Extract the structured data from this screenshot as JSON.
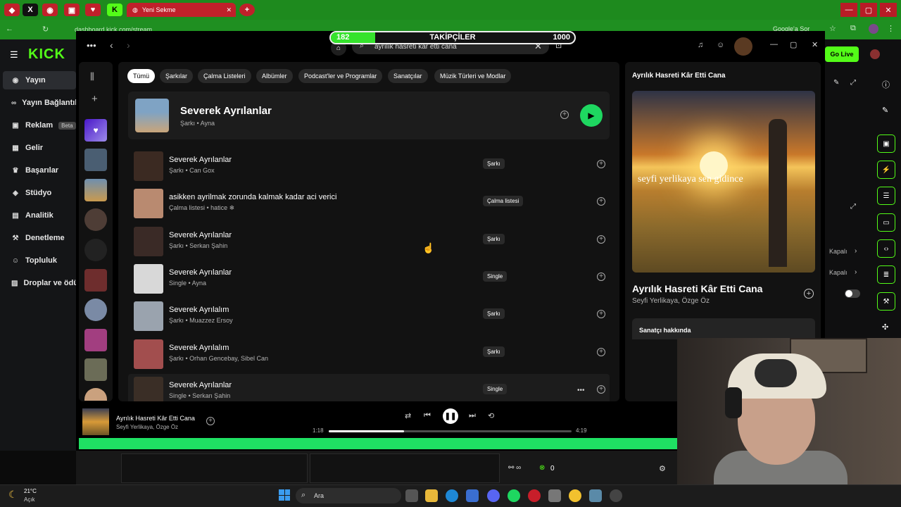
{
  "browser": {
    "tab_title": "Yeni Sekme",
    "url": "dashboard.kick.com/stream",
    "google_signin": "Google'a Sor"
  },
  "kick": {
    "logo": "KICK",
    "nav": [
      {
        "label": "Yayın",
        "icon": "broadcast-icon"
      },
      {
        "label": "Yayın Bağlantıları",
        "icon": "link-icon"
      },
      {
        "label": "Reklam",
        "icon": "ad-icon"
      },
      {
        "label": "Gelir",
        "icon": "revenue-icon"
      },
      {
        "label": "Başarılar",
        "icon": "trophy-icon"
      },
      {
        "label": "Stüdyo",
        "icon": "studio-icon"
      },
      {
        "label": "Analitik",
        "icon": "analytics-icon"
      },
      {
        "label": "Denetleme",
        "icon": "moderation-icon"
      },
      {
        "label": "Topluluk",
        "icon": "community-icon"
      },
      {
        "label": "Droplar ve ödüller",
        "icon": "drops-icon"
      }
    ],
    "beta_label": "Beta",
    "go_live": "Go Live",
    "kapali_1": "Kapalı",
    "kapali_2": "Kapalı"
  },
  "overlay": {
    "follower_label": "TAKİPÇİLER",
    "follower_current": "182",
    "follower_goal": "1000",
    "follower_fraction": 0.182
  },
  "search": {
    "query": "ayrılık hasreti kar etti cana"
  },
  "filters": [
    "Tümü",
    "Şarkılar",
    "Çalma Listeleri",
    "Albümler",
    "Podcast'ler ve Programlar",
    "Sanatçılar",
    "Müzik Türleri ve Modlar"
  ],
  "top_result": {
    "title": "Severek Ayrılanlar",
    "subtitle": "Şarkı • Ayna"
  },
  "results": [
    {
      "title": "Severek Ayrılanlar",
      "subtitle": "Şarkı • Can Gox",
      "type": "Şarkı"
    },
    {
      "title": "asikken ayrilmak zorunda kalmak kadar aci verici",
      "subtitle": "Çalma listesi • hatice ❄",
      "type": "Çalma listesi"
    },
    {
      "title": "Severek Ayrılanlar",
      "subtitle": "Şarkı • Serkan Şahin",
      "type": "Şarkı"
    },
    {
      "title": "Severek Ayrılanlar",
      "subtitle": "Single • Ayna",
      "type": "Single"
    },
    {
      "title": "Severek Ayrılalım",
      "subtitle": "Şarkı • Muazzez Ersoy",
      "type": "Şarkı"
    },
    {
      "title": "Severek Ayrılalım",
      "subtitle": "Şarkı • Orhan Gencebay, Sibel Can",
      "type": "Şarkı"
    },
    {
      "title": "Severek Ayrılanlar",
      "subtitle": "Single • Serkan Şahin",
      "type": "Single"
    }
  ],
  "now_playing_panel": {
    "header": "Ayrılık Hasreti Kâr Etti Cana",
    "title": "Ayrılık Hasreti Kâr Etti Cana",
    "artists": "Seyfi Yerlikaya, Özge Öz",
    "cover_text": "seyfi yerlikaya sen gidince",
    "about_artist": "Sanatçı hakkında"
  },
  "player": {
    "title": "Ayrılık Hasreti Kâr Etti Cana",
    "artists": "Seyfi Yerlikaya, Özge Öz",
    "elapsed": "1:18",
    "duration": "4:19",
    "progress_fraction": 0.31
  },
  "bottom": {
    "count": "0"
  },
  "taskbar": {
    "weather_temp": "21°C",
    "weather_desc": "Açık",
    "search_label": "Ara"
  },
  "colors": {
    "kick_green": "#53fc18",
    "spotify_green": "#1ed760",
    "browser_green": "#1e8a1e"
  }
}
